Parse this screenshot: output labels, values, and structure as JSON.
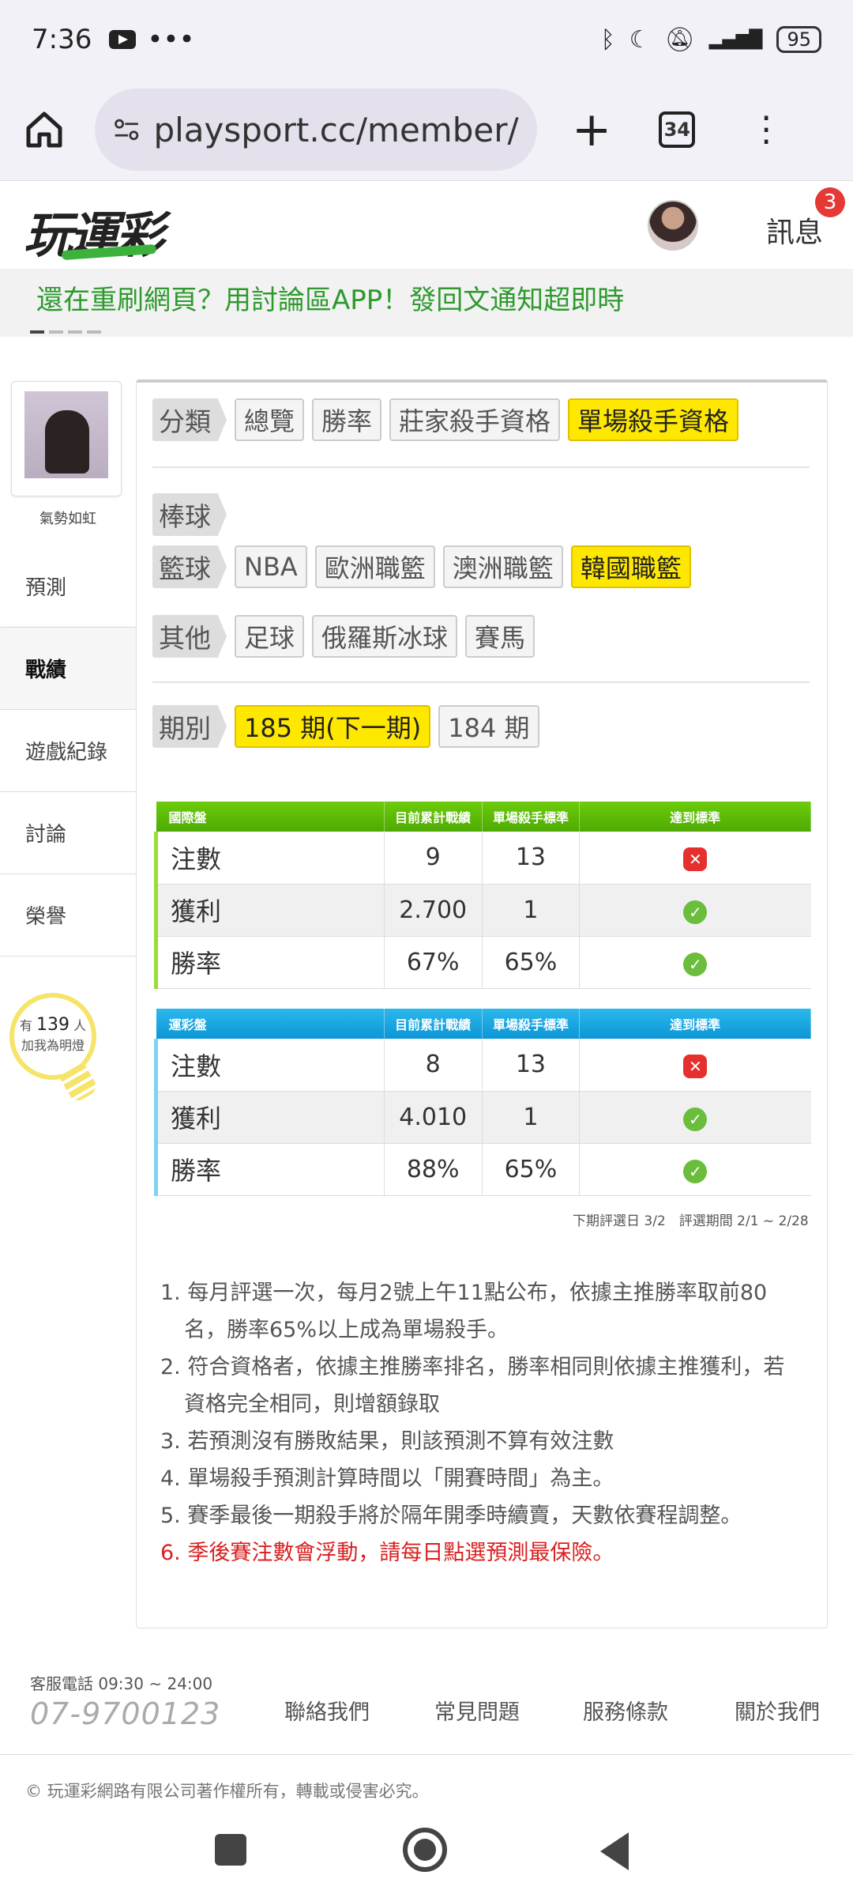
{
  "statusbar": {
    "time": "7:36",
    "battery": "95"
  },
  "browser": {
    "url": "playsport.cc/member/sk",
    "tab_count": "34"
  },
  "header": {
    "logo": "玩運彩",
    "messages_label": "訊息",
    "messages_badge": "3"
  },
  "marquee": "還在重刷網頁？用討論區APP！發回文通知超即時",
  "sidebar": {
    "username": "氣勢如虹",
    "items": [
      "預測",
      "戰績",
      "遊戲紀錄",
      "討論",
      "榮譽"
    ],
    "bulb_prefix": "有",
    "bulb_count": "139",
    "bulb_suffix": "人",
    "bulb_text": "加我為明燈"
  },
  "filters": {
    "category": {
      "label": "分類",
      "options": [
        "總覽",
        "勝率",
        "莊家殺手資格",
        "單場殺手資格"
      ],
      "selected": "單場殺手資格"
    },
    "baseball": {
      "label": "棒球"
    },
    "basketball": {
      "label": "籃球",
      "options": [
        "NBA",
        "歐洲職籃",
        "澳洲職籃",
        "韓國職籃"
      ],
      "selected": "韓國職籃"
    },
    "other": {
      "label": "其他",
      "options": [
        "足球",
        "俄羅斯冰球",
        "賽馬"
      ]
    },
    "period": {
      "label": "期別",
      "options": [
        "185 期(下一期)",
        "184 期"
      ],
      "selected": "185 期(下一期)"
    }
  },
  "tables": [
    {
      "name": "國際盤",
      "headers": [
        "國際盤",
        "目前累計戰績",
        "單場殺手標準",
        "達到標準"
      ],
      "rows": [
        {
          "label": "注數",
          "current": "9",
          "standard": "13",
          "met": false
        },
        {
          "label": "獲利",
          "current": "2.700",
          "standard": "1",
          "met": true
        },
        {
          "label": "勝率",
          "current": "67%",
          "standard": "65%",
          "met": true
        }
      ]
    },
    {
      "name": "運彩盤",
      "headers": [
        "運彩盤",
        "目前累計戰績",
        "單場殺手標準",
        "達到標準"
      ],
      "rows": [
        {
          "label": "注數",
          "current": "8",
          "standard": "13",
          "met": false
        },
        {
          "label": "獲利",
          "current": "4.010",
          "standard": "1",
          "met": true
        },
        {
          "label": "勝率",
          "current": "88%",
          "standard": "65%",
          "met": true
        }
      ]
    }
  ],
  "eval_note": "下期評選日 3/2　評選期間 2/1 ~ 2/28",
  "rules": [
    "1. 每月評選一次，每月2號上午11點公布，依據主推勝率取前80名，勝率65%以上成為單場殺手。",
    "2. 符合資格者，依據主推勝率排名，勝率相同則依據主推獲利，若資格完全相同，則增額錄取",
    "3. 若預測沒有勝敗結果，則該預測不算有效注數",
    "4. 單場殺手預測計算時間以「開賽時間」為主。",
    "5. 賽季最後一期殺手將於隔年開季時續賣，天數依賽程調整。",
    "6. 季後賽注數會浮動，請每日點選預測最保險。"
  ],
  "footer": {
    "cs_label": "客服電話 09:30 ~ 24:00",
    "phone": "07-9700123",
    "links": [
      "聯絡我們",
      "常見問題",
      "服務條款",
      "關於我們"
    ],
    "copyright": "© 玩運彩網路有限公司著作權所有，轉載或侵害必究。"
  },
  "colors": {
    "accent_yellow": "#ffe800",
    "green_header": "#5bb806",
    "blue_header": "#14a4e0",
    "marquee_green": "#2e9a2e",
    "warning_red": "#d91f1f"
  }
}
